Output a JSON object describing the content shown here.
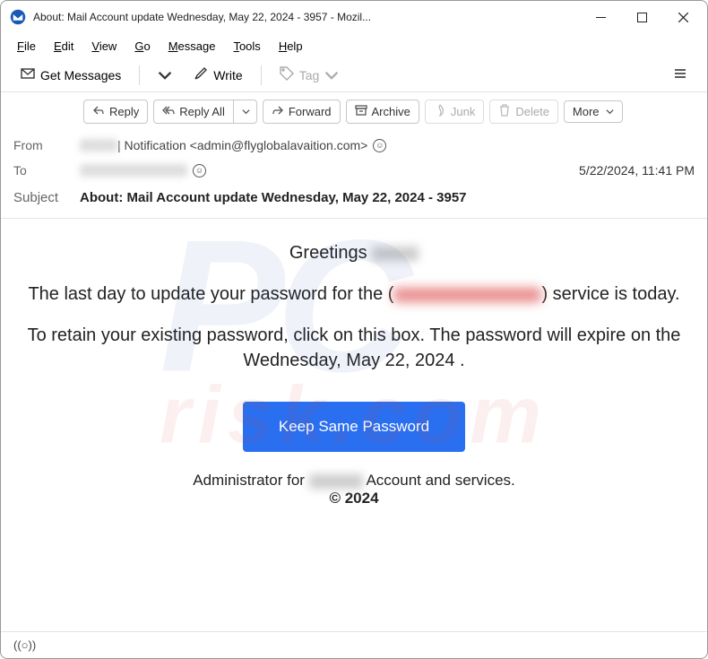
{
  "window": {
    "title": "About: Mail Account update Wednesday, May 22, 2024 - 3957 - Mozil..."
  },
  "menubar": [
    "File",
    "Edit",
    "View",
    "Go",
    "Message",
    "Tools",
    "Help"
  ],
  "toolbar1": {
    "getMessages": "Get Messages",
    "write": "Write",
    "tag": "Tag"
  },
  "toolbar2": {
    "reply": "Reply",
    "replyAll": "Reply All",
    "forward": "Forward",
    "archive": "Archive",
    "junk": "Junk",
    "delete": "Delete",
    "more": "More"
  },
  "headers": {
    "fromLabel": "From",
    "fromRedacted": "xxxxx",
    "fromSep": " | Notification <",
    "fromEmail": "admin@flyglobalavaition.com",
    "fromClose": ">",
    "toLabel": "To",
    "toRedacted": "xxxxxxxxxxxxxxx",
    "date": "5/22/2024, 11:41 PM",
    "subjectLabel": "Subject",
    "subject": "About: Mail Account update Wednesday, May 22, 2024 - 3957"
  },
  "body": {
    "greeting": "Greetings ",
    "p1a": "The last day to update your password for the (",
    "p1b": ") service is today.",
    "p2": "To retain your existing password, click on this box. The password will expire on the Wednesday, May 22, 2024 .",
    "cta": "Keep Same Password",
    "footer1a": "Administrator for ",
    "footer1b": " Account and services.",
    "copyright": "© 2024"
  },
  "statusbar": {
    "sync": "((○))"
  },
  "watermark": {
    "line1": "PC",
    "line2": "risk.com"
  }
}
